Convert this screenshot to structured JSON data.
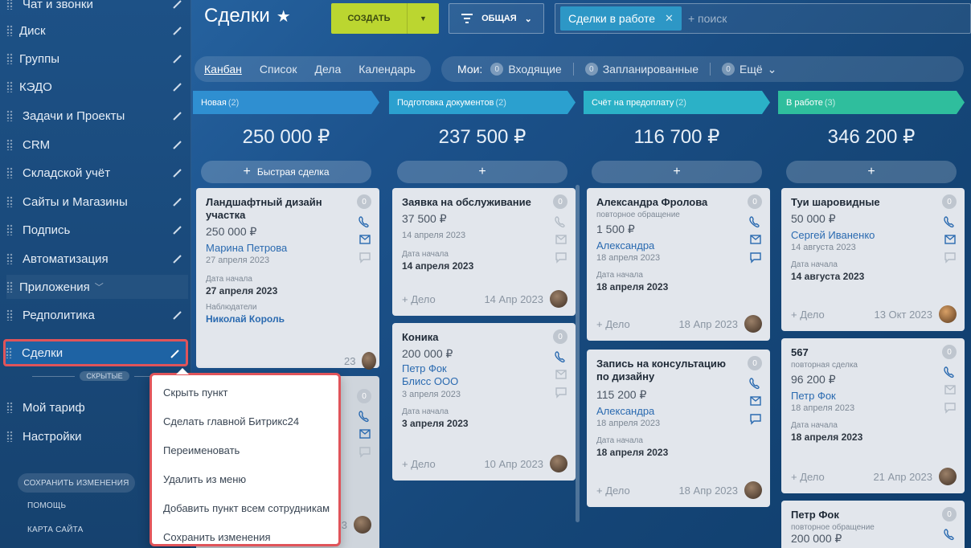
{
  "sidebar": {
    "items": [
      {
        "label": "Чат и звонки"
      },
      {
        "label": "Диск"
      },
      {
        "label": "Группы"
      },
      {
        "label": "КЭДО"
      },
      {
        "label": "Задачи и Проекты"
      },
      {
        "label": "CRM"
      },
      {
        "label": "Складской учёт"
      },
      {
        "label": "Сайты и Магазины"
      },
      {
        "label": "Подпись"
      },
      {
        "label": "Автоматизация"
      },
      {
        "label": "Приложения"
      },
      {
        "label": "Редполитика"
      },
      {
        "label": "Сделки"
      },
      {
        "label": "Мой тариф"
      },
      {
        "label": "Настройки"
      }
    ],
    "hidden_label": "СКРЫТЫЕ",
    "save_changes": "СОХРАНИТЬ ИЗМЕНЕНИЯ",
    "help": "ПОМОЩЬ",
    "sitemap": "КАРТА САЙТА"
  },
  "header": {
    "title": "Сделки",
    "create": "СОЗДАТЬ",
    "filter": "ОБЩАЯ",
    "chip": "Сделки в работе",
    "search_placeholder": "+ поиск"
  },
  "views": [
    "Канбан",
    "Список",
    "Дела",
    "Календарь"
  ],
  "counters": {
    "mine": "Мои:",
    "items": [
      {
        "n": "0",
        "label": "Входящие"
      },
      {
        "n": "0",
        "label": "Запланированные"
      },
      {
        "n": "0",
        "label": "Ещё"
      }
    ]
  },
  "columns": [
    {
      "name": "Новая",
      "count": "(2)",
      "total": "250 000 ₽",
      "add": "Быстрая сделка",
      "color": "#2f8fd1"
    },
    {
      "name": "Подготовка документов",
      "count": "(2)",
      "total": "237 500 ₽",
      "add": "",
      "color": "#2ba0cf"
    },
    {
      "name": "Счёт на предоплату",
      "count": "(2)",
      "total": "116 700 ₽",
      "add": "",
      "color": "#2bb1c7"
    },
    {
      "name": "В работе",
      "count": "(3)",
      "total": "346 200 ₽",
      "add": "",
      "color": "#2fbe9d"
    }
  ],
  "cards": {
    "c1": {
      "title": "Ландшафтный дизайн участка",
      "badge": "0",
      "price": "250 000 ₽",
      "contact": "Марина Петрова",
      "date": "27 апреля 2023",
      "start_label": "Дата начала",
      "start": "27 апреля 2023",
      "obs_label": "Наблюдатели",
      "obs": "Николай Король",
      "foot_date": "23"
    },
    "c1b": {
      "badge": "0",
      "foot_date": "23"
    },
    "c2": {
      "title": "Заявка на обслуживание",
      "badge": "0",
      "price": "37 500 ₽",
      "date": "14 апреля 2023",
      "start_label": "Дата начала",
      "start": "14 апреля 2023",
      "deal": "+ Дело",
      "foot_date": "14 Апр 2023"
    },
    "c3": {
      "title": "Коника",
      "badge": "0",
      "price": "200 000 ₽",
      "contact": "Петр Фок",
      "company": "Блисс ООО",
      "date": "3 апреля 2023",
      "start_label": "Дата начала",
      "start": "3 апреля 2023",
      "deal": "+ Дело",
      "foot_date": "10 Апр 2023"
    },
    "c4": {
      "title": "Александра Фролова",
      "sub": "повторное обращение",
      "badge": "0",
      "price": "1 500 ₽",
      "contact": "Александра",
      "date": "18 апреля 2023",
      "start_label": "Дата начала",
      "start": "18 апреля 2023",
      "deal": "+ Дело",
      "foot_date": "18 Апр 2023"
    },
    "c5": {
      "title": "Запись на консультацию по дизайну",
      "badge": "0",
      "price": "115 200 ₽",
      "contact": "Александра",
      "date": "18 апреля 2023",
      "start_label": "Дата начала",
      "start": "18 апреля 2023",
      "deal": "+ Дело",
      "foot_date": "18 Апр 2023"
    },
    "c6": {
      "title": "Туи шаровидные",
      "badge": "0",
      "price": "50 000 ₽",
      "contact": "Сергей Иваненко",
      "date": "14 августа 2023",
      "start_label": "Дата начала",
      "start": "14 августа 2023",
      "deal": "+ Дело",
      "foot_date": "13 Окт 2023"
    },
    "c7": {
      "title": "567",
      "sub": "повторная сделка",
      "badge": "0",
      "price": "96 200 ₽",
      "contact": "Петр Фок",
      "date": "18 апреля 2023",
      "start_label": "Дата начала",
      "start": "18 апреля 2023",
      "deal": "+ Дело",
      "foot_date": "21 Апр 2023"
    },
    "c8": {
      "title": "Петр Фок",
      "sub": "повторное обращение",
      "badge": "0",
      "price": "200 000 ₽"
    }
  },
  "context_menu": [
    "Скрыть пункт",
    "Сделать главной Битрикс24",
    "Переименовать",
    "Удалить из меню",
    "Добавить пункт всем сотрудникам",
    "Сохранить изменения"
  ]
}
